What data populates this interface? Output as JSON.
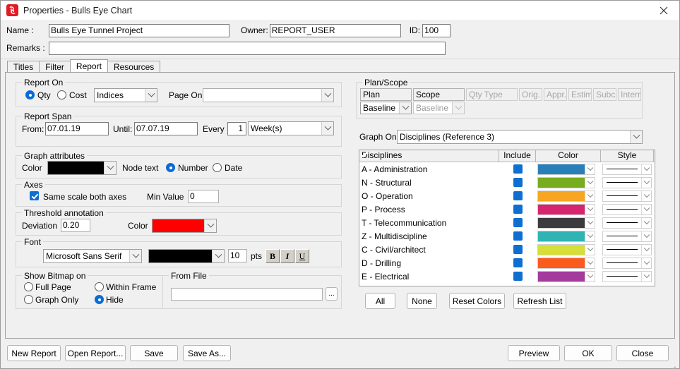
{
  "window": {
    "title": "Properties - Bulls Eye Chart",
    "app_icon": "app-logo-icon",
    "close_icon": "close-icon"
  },
  "header": {
    "name_label": "Name :",
    "name_value": "Bulls Eye Tunnel Project",
    "owner_label": "Owner:",
    "owner_value": "REPORT_USER",
    "id_label": "ID:",
    "id_value": "100",
    "remarks_label": "Remarks :",
    "remarks_value": ""
  },
  "tabs": [
    {
      "label": "Titles",
      "active": false
    },
    {
      "label": "Filter",
      "active": false
    },
    {
      "label": "Report",
      "active": true
    },
    {
      "label": "Resources",
      "active": false
    }
  ],
  "report_on": {
    "legend": "Report On",
    "qty_label": "Qty",
    "qty_selected": true,
    "cost_label": "Cost",
    "cost_selected": false,
    "indices_value": "Indices",
    "page_on_label": "Page On:",
    "page_on_value": ""
  },
  "report_span": {
    "legend": "Report Span",
    "from_label": "From:",
    "from_value": "07.01.19",
    "until_label": "Until:",
    "until_value": "07.07.19",
    "every_label": "Every",
    "every_value": "1",
    "unit_value": "Week(s)"
  },
  "graph_attributes": {
    "legend": "Graph attributes",
    "color_label": "Color",
    "color_value": "#000000",
    "node_text_label": "Node text",
    "number_label": "Number",
    "number_selected": true,
    "date_label": "Date",
    "date_selected": false
  },
  "axes": {
    "legend": "Axes",
    "same_scale_label": "Same scale both axes",
    "same_scale_checked": true,
    "min_value_label": "Min Value",
    "min_value": "0"
  },
  "threshold": {
    "legend": "Threshold annotation",
    "deviation_label": "Deviation",
    "deviation_value": "0.20",
    "color_label": "Color",
    "color_value": "#ff0000"
  },
  "font": {
    "legend": "Font",
    "family_value": "Microsoft Sans Serif",
    "color_value": "#000000",
    "size_value": "10",
    "pts_label": "pts",
    "bold_label": "B",
    "italic_label": "I",
    "underline_label": "U"
  },
  "bitmap": {
    "legend": "Show Bitmap on",
    "full_page_label": "Full Page",
    "full_page_selected": false,
    "graph_only_label": "Graph Only",
    "graph_only_selected": false,
    "within_frame_label": "Within Frame",
    "within_frame_selected": false,
    "hide_label": "Hide",
    "hide_selected": true,
    "from_file_legend": "From File",
    "from_file_value": "",
    "browse_label": "..."
  },
  "plan_scope": {
    "legend": "Plan/Scope",
    "columns": [
      {
        "label": "Plan",
        "enabled": true
      },
      {
        "label": "Scope",
        "enabled": true
      },
      {
        "label": "Qty Type",
        "enabled": false
      },
      {
        "label": "Orig.",
        "enabled": false
      },
      {
        "label": "Appr.",
        "enabled": false
      },
      {
        "label": "Estim.",
        "enabled": false
      },
      {
        "label": "Subc.",
        "enabled": false
      },
      {
        "label": "Intern",
        "enabled": false
      }
    ],
    "plan_value": "Baseline",
    "scope_value": "Baseline"
  },
  "graph_on": {
    "label": "Graph On:",
    "value": "Disciplines (Reference 3)"
  },
  "disciplines_table": {
    "columns": [
      "Disciplines",
      "Include",
      "Color",
      "Style"
    ],
    "rows": [
      {
        "name": "A - Administration",
        "include": true,
        "color": "#2980b9",
        "style": "solid"
      },
      {
        "name": "N - Structural",
        "include": true,
        "color": "#76ac1e",
        "style": "solid"
      },
      {
        "name": "O - Operation",
        "include": true,
        "color": "#f6a623",
        "style": "solid"
      },
      {
        "name": "P - Process",
        "include": true,
        "color": "#d6246f",
        "style": "solid"
      },
      {
        "name": "T - Telecommunication",
        "include": true,
        "color": "#3b3b3d",
        "style": "solid"
      },
      {
        "name": "Z - Multidiscipline",
        "include": true,
        "color": "#30b3b3",
        "style": "solid"
      },
      {
        "name": "C - Civil/architect",
        "include": true,
        "color": "#d6df38",
        "style": "solid"
      },
      {
        "name": "D - Drilling",
        "include": true,
        "color": "#fb5c1e",
        "style": "solid"
      },
      {
        "name": "E - Electrical",
        "include": true,
        "color": "#a43a9b",
        "style": "solid"
      }
    ]
  },
  "list_actions": {
    "all": "All",
    "none": "None",
    "reset_colors": "Reset Colors",
    "refresh_list": "Refresh List"
  },
  "footer": {
    "new_report": "New Report",
    "open_report": "Open Report...",
    "save": "Save",
    "save_as": "Save As...",
    "preview": "Preview",
    "ok": "OK",
    "close": "Close"
  }
}
